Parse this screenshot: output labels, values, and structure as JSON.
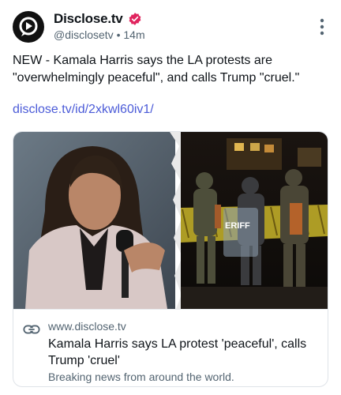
{
  "account": {
    "display_name": "Disclose.tv",
    "handle": "@disclosetv",
    "separator": "•",
    "time": "14m"
  },
  "post": {
    "text": "NEW - Kamala Harris says the LA protests are \"overwhelmingly peaceful\", and calls Trump \"cruel.\"",
    "link": "disclose.tv/id/2xkwl60iv1/"
  },
  "card": {
    "domain": "www.disclose.tv",
    "title": "Kamala Harris says LA protest 'peaceful', calls Trump 'cruel'",
    "description": "Breaking news from around the world.",
    "police_shield_text": "ERIFF"
  },
  "icons": {
    "avatar": "play-chat-logo",
    "verified": "verified-badge-icon",
    "more": "more-vertical-icon",
    "link": "link-icon"
  },
  "colors": {
    "verified_badge": "#e0245e",
    "link": "#4b5bd8",
    "muted_text": "#536471"
  }
}
